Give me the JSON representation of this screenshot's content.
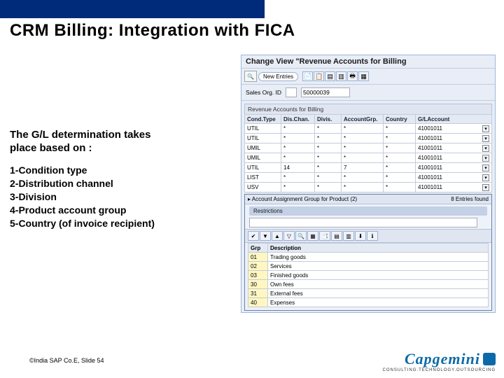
{
  "slide": {
    "title": "CRM Billing: Integration with FICA",
    "subhead": "The G/L determination takes place based on :",
    "criteria": [
      "1-Condition type",
      "2-Distribution channel",
      "3-Division",
      "4-Product account group",
      "5-Country (of invoice recipient)"
    ],
    "footer": "©India SAP Co.E, Slide 54",
    "logo_brand": "Capgemini",
    "logo_tag": "CONSULTING.TECHNOLOGY.OUTSOURCING"
  },
  "sap": {
    "windowTitle": "Change View \"Revenue Accounts for Billing",
    "newEntriesBtn": "New Entries",
    "salesOrgLabel": "Sales Org. ID",
    "salesOrgValue": "50000039",
    "tableTitle": "Revenue Accounts for Billing",
    "headers": [
      "Cond.Type",
      "Dis.Chan.",
      "Divis.",
      "AccountGrp.",
      "Country",
      "G/LAccount"
    ],
    "rows": [
      [
        "UTIL",
        "*",
        "*",
        "*",
        "*",
        "41001011"
      ],
      [
        "UTIL",
        "*",
        "*",
        "*",
        "*",
        "41001011"
      ],
      [
        "UMIL",
        "*",
        "*",
        "*",
        "*",
        "41001011"
      ],
      [
        "UMIL",
        "*",
        "*",
        "*",
        "*",
        "41001011"
      ],
      [
        "UTIL",
        "14",
        "*",
        "7",
        "*",
        "41001011"
      ],
      [
        "LIST",
        "*",
        "*",
        "*",
        "*",
        "41001011"
      ],
      [
        "USV",
        "*",
        "*",
        "*",
        "*",
        "41001011"
      ]
    ],
    "popupTitle": "▸ Account Assignment Group for Product (2)",
    "popupCount": "8 Entries found",
    "restrictions": "Restrictions",
    "popupHeaders": [
      "Grp",
      "Description"
    ],
    "popupRows": [
      [
        "01",
        "Trading goods"
      ],
      [
        "02",
        "Services"
      ],
      [
        "03",
        "Finished goods"
      ],
      [
        "30",
        "Own fees"
      ],
      [
        "31",
        "External fees"
      ],
      [
        "40",
        "Expenses"
      ]
    ]
  }
}
